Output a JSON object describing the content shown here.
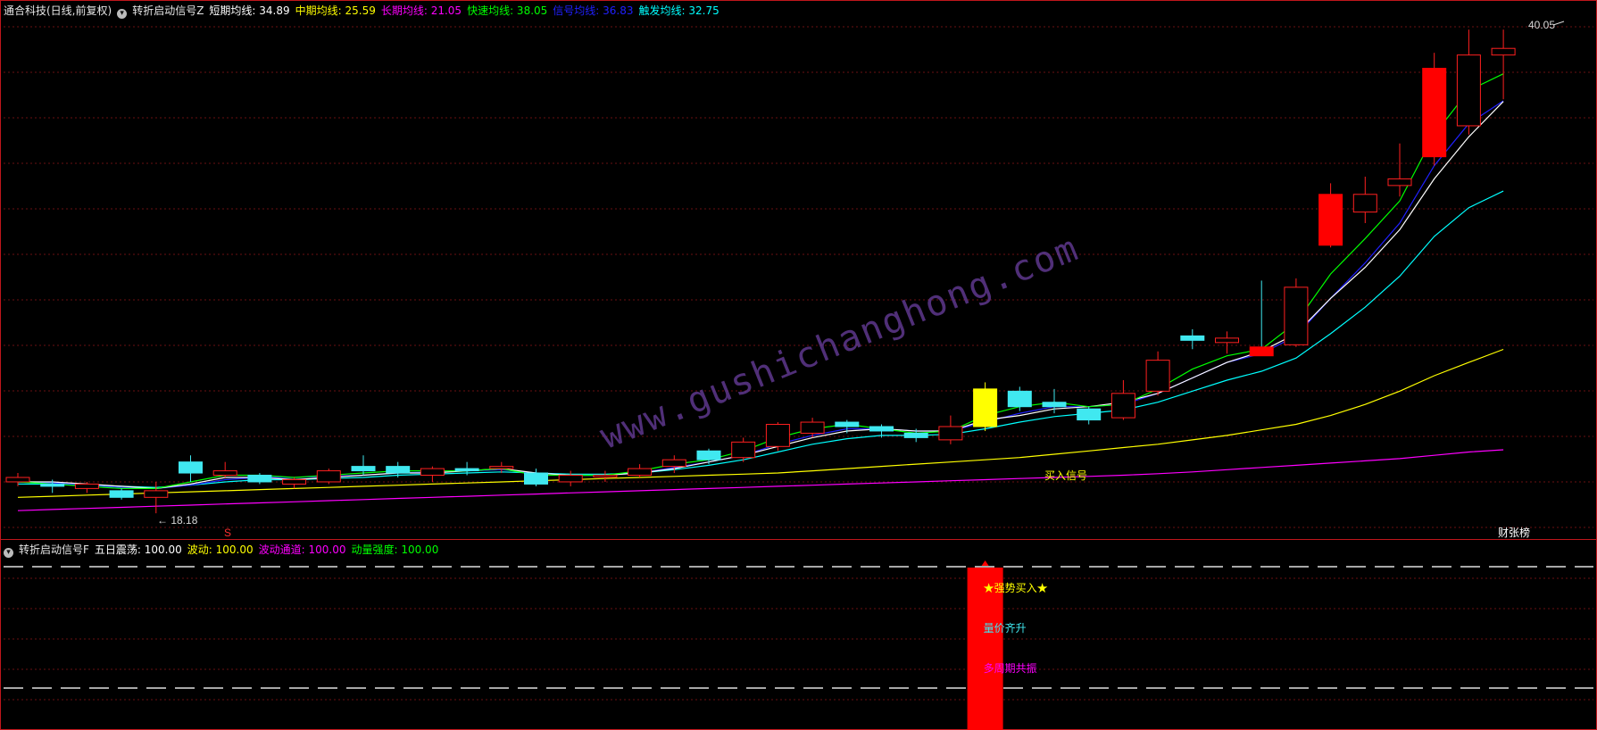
{
  "main_header": {
    "title": "通合科技(日线,前复权)",
    "indicator_name": "转折启动信号Z",
    "items": [
      {
        "label": "短期均线",
        "value": "34.89",
        "color": "#ffffff"
      },
      {
        "label": "中期均线",
        "value": "25.59",
        "color": "#ffff00"
      },
      {
        "label": "长期均线",
        "value": "21.05",
        "color": "#ff00ff"
      },
      {
        "label": "快速均线",
        "value": "38.05",
        "color": "#00ff00"
      },
      {
        "label": "信号均线",
        "value": "36.83",
        "color": "#2020ff"
      },
      {
        "label": "触发均线",
        "value": "32.75",
        "color": "#00ffff"
      }
    ]
  },
  "sub_header": {
    "indicator_name": "转折启动信号F",
    "items": [
      {
        "label": "五日震荡",
        "value": "100.00",
        "color": "#ffffff"
      },
      {
        "label": "波动",
        "value": "100.00",
        "color": "#ffff00"
      },
      {
        "label": "波动通道",
        "value": "100.00",
        "color": "#ff00ff"
      },
      {
        "label": "动量强度",
        "value": "100.00",
        "color": "#00ff00"
      }
    ]
  },
  "annotations": {
    "high_price": "40.05",
    "low_price": "18.18",
    "buy_signal": "买入信号",
    "s_marker": "S",
    "caizhang": "财张榜",
    "strong_buy": "★强势买入★",
    "vol_price": "量价齐升",
    "multi_cycle": "多周期共振"
  },
  "watermark": "www.gushichanghong.com",
  "chart_data": {
    "type": "candlestick",
    "candles": [
      {
        "o": 19.6,
        "c": 19.8,
        "h": 20.0,
        "l": 19.4
      },
      {
        "o": 19.5,
        "c": 19.4,
        "h": 19.7,
        "l": 19.1
      },
      {
        "o": 19.3,
        "c": 19.5,
        "h": 19.6,
        "l": 19.1
      },
      {
        "o": 19.2,
        "c": 18.9,
        "h": 19.3,
        "l": 18.8
      },
      {
        "o": 18.9,
        "c": 19.2,
        "h": 19.6,
        "l": 18.18
      },
      {
        "o": 20.5,
        "c": 20.0,
        "h": 20.8,
        "l": 19.6
      },
      {
        "o": 19.9,
        "c": 20.1,
        "h": 20.5,
        "l": 19.8
      },
      {
        "o": 19.9,
        "c": 19.6,
        "h": 20.0,
        "l": 19.5
      },
      {
        "o": 19.5,
        "c": 19.7,
        "h": 19.8,
        "l": 19.3
      },
      {
        "o": 19.6,
        "c": 20.1,
        "h": 20.2,
        "l": 19.5
      },
      {
        "o": 20.3,
        "c": 20.1,
        "h": 20.8,
        "l": 19.9
      },
      {
        "o": 20.3,
        "c": 20.0,
        "h": 20.5,
        "l": 19.8
      },
      {
        "o": 19.9,
        "c": 20.2,
        "h": 20.3,
        "l": 19.6
      },
      {
        "o": 20.2,
        "c": 20.1,
        "h": 20.5,
        "l": 19.9
      },
      {
        "o": 20.2,
        "c": 20.3,
        "h": 20.5,
        "l": 20.0
      },
      {
        "o": 20.0,
        "c": 19.5,
        "h": 20.2,
        "l": 19.4
      },
      {
        "o": 19.6,
        "c": 19.9,
        "h": 20.1,
        "l": 19.4
      },
      {
        "o": 19.9,
        "c": 19.9,
        "h": 20.1,
        "l": 19.6
      },
      {
        "o": 19.9,
        "c": 20.2,
        "h": 20.4,
        "l": 19.8
      },
      {
        "o": 20.3,
        "c": 20.6,
        "h": 20.8,
        "l": 20.0
      },
      {
        "o": 21.0,
        "c": 20.6,
        "h": 21.1,
        "l": 20.4
      },
      {
        "o": 20.7,
        "c": 21.4,
        "h": 21.6,
        "l": 20.5
      },
      {
        "o": 21.2,
        "c": 22.2,
        "h": 22.3,
        "l": 21.0
      },
      {
        "o": 21.8,
        "c": 22.3,
        "h": 22.5,
        "l": 21.6
      },
      {
        "o": 22.3,
        "c": 22.1,
        "h": 22.4,
        "l": 21.8
      },
      {
        "o": 22.1,
        "c": 21.9,
        "h": 22.2,
        "l": 21.6
      },
      {
        "o": 21.8,
        "c": 21.6,
        "h": 22.0,
        "l": 21.4
      },
      {
        "o": 21.5,
        "c": 22.1,
        "h": 22.6,
        "l": 21.3
      },
      {
        "o": 22.1,
        "c": 23.8,
        "h": 24.1,
        "l": 21.9
      },
      {
        "o": 23.7,
        "c": 23.0,
        "h": 23.9,
        "l": 22.8
      },
      {
        "o": 23.2,
        "c": 23.0,
        "h": 23.8,
        "l": 22.7
      },
      {
        "o": 22.9,
        "c": 22.4,
        "h": 23.0,
        "l": 22.2
      },
      {
        "o": 22.5,
        "c": 23.6,
        "h": 24.2,
        "l": 22.4
      },
      {
        "o": 23.7,
        "c": 25.1,
        "h": 25.5,
        "l": 23.5
      },
      {
        "o": 26.2,
        "c": 26.0,
        "h": 26.5,
        "l": 25.6
      },
      {
        "o": 25.9,
        "c": 26.1,
        "h": 26.4,
        "l": 25.4
      },
      {
        "o": 25.7,
        "c": 25.3,
        "h": 28.7,
        "l": 25.3
      },
      {
        "o": 25.8,
        "c": 28.4,
        "h": 28.8,
        "l": 25.7
      },
      {
        "o": 30.3,
        "c": 32.6,
        "h": 33.1,
        "l": 30.2
      },
      {
        "o": 31.8,
        "c": 32.6,
        "h": 33.4,
        "l": 31.3
      },
      {
        "o": 33.0,
        "c": 33.3,
        "h": 34.9,
        "l": 32.5
      },
      {
        "o": 34.3,
        "c": 38.3,
        "h": 39.0,
        "l": 33.9
      },
      {
        "o": 35.7,
        "c": 38.9,
        "h": 40.05,
        "l": 35.3
      },
      {
        "o": 38.9,
        "c": 39.2,
        "h": 40.05,
        "l": 36.9
      }
    ],
    "ylim": [
      17.5,
      40.5
    ],
    "series": [
      {
        "name": "短期均线",
        "values": [
          19.6,
          19.6,
          19.5,
          19.4,
          19.3,
          19.5,
          19.8,
          19.8,
          19.7,
          19.8,
          19.9,
          20.0,
          20.0,
          20.1,
          20.2,
          20.0,
          19.9,
          19.9,
          20.0,
          20.2,
          20.5,
          20.8,
          21.2,
          21.6,
          21.9,
          22.0,
          21.9,
          21.9,
          22.4,
          22.6,
          22.9,
          23.0,
          23.2,
          23.6,
          24.3,
          25.0,
          25.5,
          26.3,
          27.9,
          29.3,
          31.0,
          33.3,
          35.2,
          36.8
        ]
      },
      {
        "name": "中期均线",
        "values": [
          18.9,
          18.95,
          19.0,
          19.05,
          19.1,
          19.15,
          19.2,
          19.25,
          19.3,
          19.35,
          19.4,
          19.45,
          19.5,
          19.55,
          19.6,
          19.65,
          19.7,
          19.75,
          19.8,
          19.85,
          19.9,
          19.95,
          20.0,
          20.1,
          20.2,
          20.3,
          20.4,
          20.5,
          20.6,
          20.7,
          20.85,
          21.0,
          21.15,
          21.3,
          21.5,
          21.7,
          21.95,
          22.2,
          22.6,
          23.1,
          23.7,
          24.4,
          25.0,
          25.59
        ]
      },
      {
        "name": "长期均线",
        "values": [
          18.3,
          18.35,
          18.4,
          18.45,
          18.5,
          18.55,
          18.6,
          18.65,
          18.7,
          18.75,
          18.8,
          18.85,
          18.9,
          18.95,
          19.0,
          19.05,
          19.1,
          19.15,
          19.2,
          19.25,
          19.3,
          19.35,
          19.4,
          19.45,
          19.5,
          19.55,
          19.6,
          19.65,
          19.7,
          19.75,
          19.8,
          19.85,
          19.9,
          19.97,
          20.05,
          20.15,
          20.25,
          20.35,
          20.45,
          20.55,
          20.65,
          20.8,
          20.95,
          21.05
        ]
      },
      {
        "name": "快速均线",
        "values": [
          19.6,
          19.5,
          19.4,
          19.3,
          19.3,
          19.6,
          19.9,
          19.9,
          19.8,
          19.9,
          20.0,
          20.1,
          20.1,
          20.1,
          20.2,
          19.9,
          19.9,
          19.9,
          20.1,
          20.4,
          20.6,
          21.0,
          21.6,
          22.0,
          22.2,
          22.0,
          21.8,
          21.9,
          22.6,
          23.0,
          23.2,
          23.0,
          23.1,
          23.8,
          24.7,
          25.3,
          25.6,
          26.8,
          29.0,
          30.6,
          32.3,
          35.3,
          37.3,
          38.05
        ]
      },
      {
        "name": "信号均线",
        "values": [
          19.6,
          19.55,
          19.45,
          19.35,
          19.3,
          19.45,
          19.7,
          19.8,
          19.8,
          19.85,
          19.9,
          20.0,
          20.05,
          20.1,
          20.15,
          20.0,
          19.9,
          19.9,
          20.0,
          20.25,
          20.5,
          20.8,
          21.3,
          21.7,
          22.0,
          22.0,
          21.9,
          21.9,
          22.3,
          22.7,
          23.0,
          23.0,
          23.1,
          23.6,
          24.3,
          25.0,
          25.4,
          26.2,
          27.9,
          29.5,
          31.3,
          33.9,
          35.8,
          36.83
        ]
      },
      {
        "name": "触发均线",
        "values": [
          19.5,
          19.5,
          19.45,
          19.4,
          19.35,
          19.45,
          19.6,
          19.7,
          19.7,
          19.75,
          19.8,
          19.9,
          19.95,
          20.0,
          20.05,
          20.0,
          19.95,
          19.95,
          20.0,
          20.15,
          20.35,
          20.6,
          20.95,
          21.3,
          21.55,
          21.7,
          21.7,
          21.75,
          22.0,
          22.3,
          22.55,
          22.7,
          22.85,
          23.2,
          23.7,
          24.2,
          24.6,
          25.2,
          26.3,
          27.5,
          28.9,
          30.7,
          32.0,
          32.75
        ]
      }
    ],
    "sub_chart": {
      "type": "bar",
      "values": [
        0,
        0,
        0,
        0,
        0,
        0,
        0,
        0,
        0,
        0,
        0,
        0,
        0,
        0,
        0,
        0,
        0,
        0,
        0,
        0,
        0,
        0,
        0,
        0,
        0,
        0,
        0,
        0,
        100,
        0,
        0,
        0,
        0,
        0,
        0,
        0,
        0,
        0,
        0,
        0,
        0,
        0,
        0,
        0
      ],
      "ylim": [
        0,
        100
      ],
      "grid": "dashed"
    }
  }
}
